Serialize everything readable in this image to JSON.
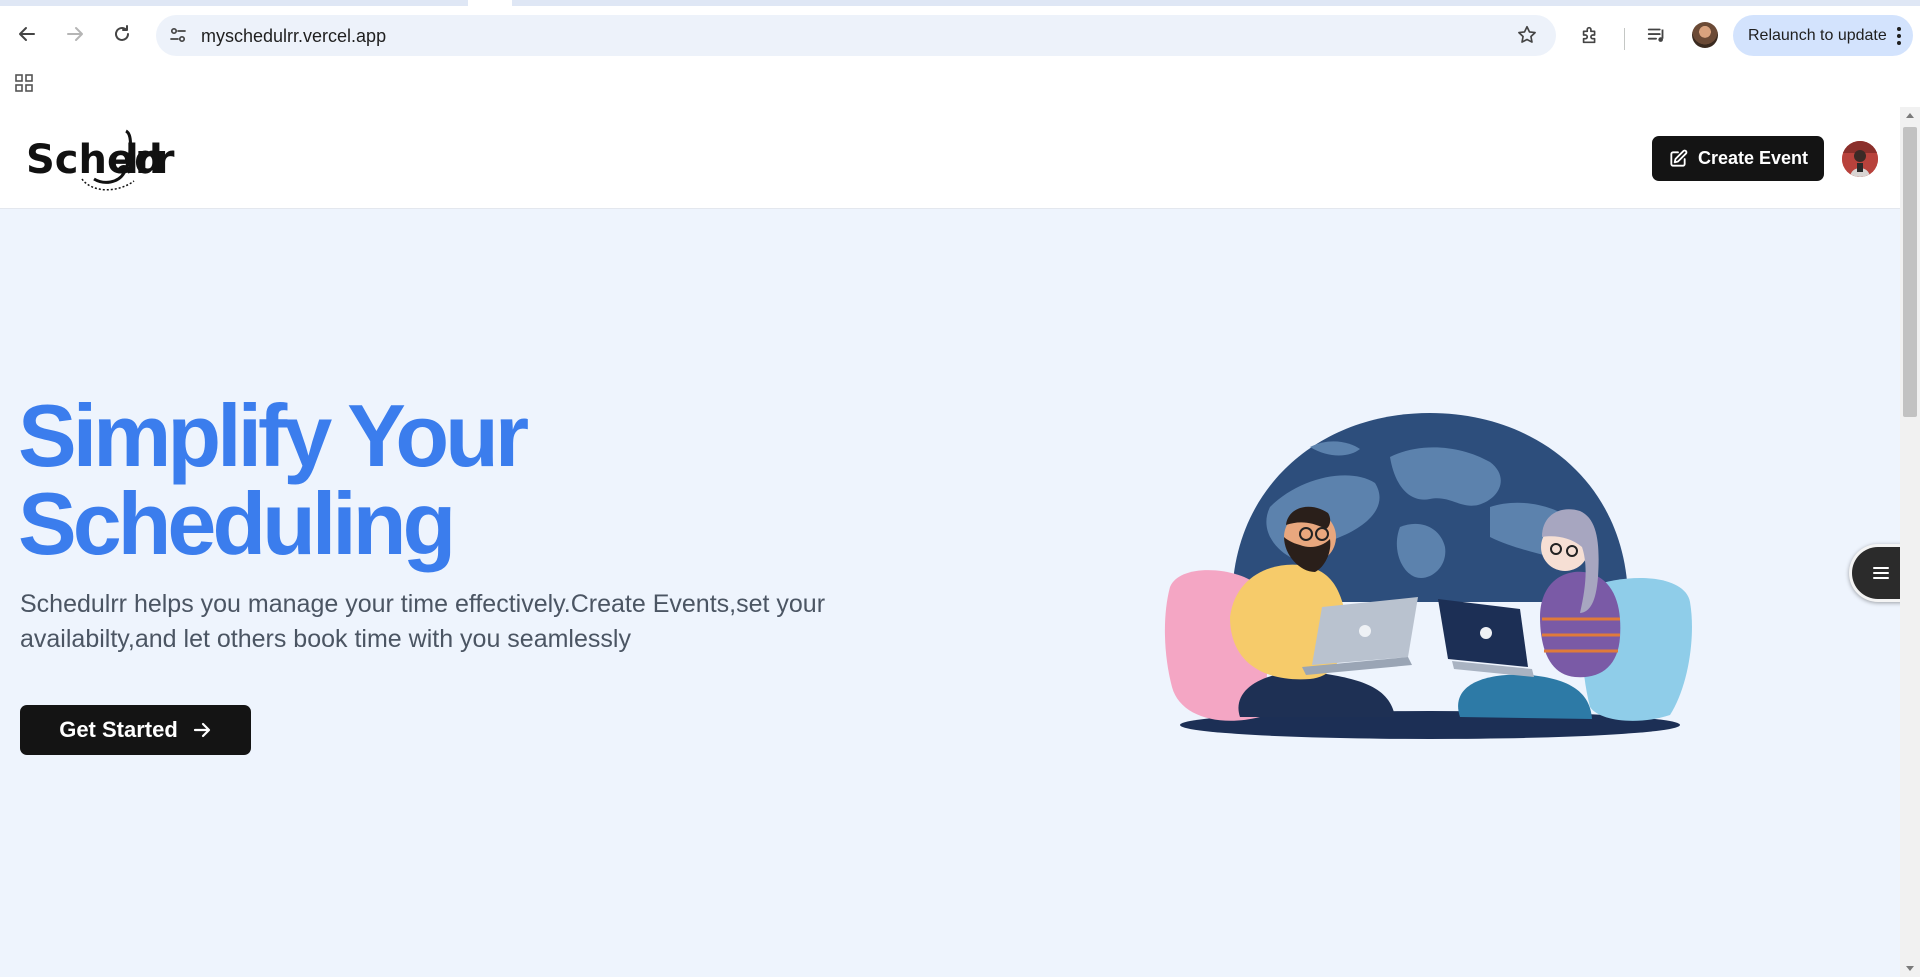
{
  "browser": {
    "url": "myschedulrr.vercel.app",
    "relaunch_label": "Relaunch to update",
    "icons": [
      "back-arrow-icon",
      "forward-arrow-icon",
      "reload-icon",
      "site-info-icon",
      "bookmark-star-icon",
      "extensions-icon",
      "media-control-icon",
      "profile-avatar",
      "more-vert-icon",
      "apps-grid-icon"
    ]
  },
  "header": {
    "logo_text": "Schedulrr",
    "create_event_label": "Create Event",
    "create_event_icon": "edit-square-icon"
  },
  "hero": {
    "title_line1": "Simplify Your",
    "title_line2": "Scheduling",
    "subtitle": "Schedulrr helps you manage your time effectively.Create Events,set your availabilty,and let others book time with you seamlessly",
    "cta_label": "Get Started",
    "cta_icon": "arrow-right-icon"
  },
  "floating_widget": {
    "icon": "menu-lines-icon"
  },
  "colors": {
    "accent_blue": "#3b7ded",
    "dark_button": "#141414",
    "page_bg": "#eef4fd",
    "subtitle_gray": "#4b5563",
    "chrome_omnibox": "#edf2fa",
    "relaunch_bg": "#d3e3fd"
  }
}
